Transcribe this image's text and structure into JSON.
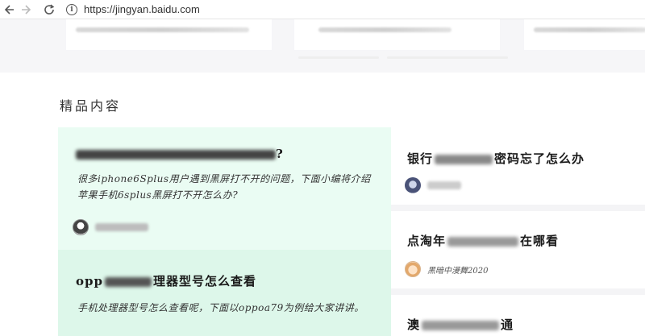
{
  "browser": {
    "url": "https://jingyan.baidu.com",
    "back_icon": "arrow-left-icon",
    "forward_icon": "arrow-right-icon",
    "reload_icon": "reload-icon",
    "info_icon": "info-icon"
  },
  "section": {
    "title": "精品内容"
  },
  "left_cards": [
    {
      "title_visible": "?",
      "desc": "很多iphone6Splus用户遇到黑屏打不开的问题，下面小编将介绍苹果手机6splus黑屏打不开怎么办?",
      "author_visible": ""
    },
    {
      "title_prefix": "opp",
      "title_suffix": "理器型号怎么查看",
      "desc": "手机处理器型号怎么查看呢，下面以oppoa79为例给大家讲讲。"
    }
  ],
  "right_cards": [
    {
      "title_prefix": "银行",
      "title_suffix": "密码忘了怎么办",
      "author_visible": ""
    },
    {
      "title_prefix": "点淘年",
      "title_suffix": "在哪看",
      "author": "黑暗中漫舞2020"
    },
    {
      "title_prefix": "澳",
      "title_suffix": "通"
    }
  ],
  "colors": {
    "left_card_1": "#eafcf3",
    "left_card_2": "#ddf7ea",
    "right_bg": "#f4f4f6"
  }
}
